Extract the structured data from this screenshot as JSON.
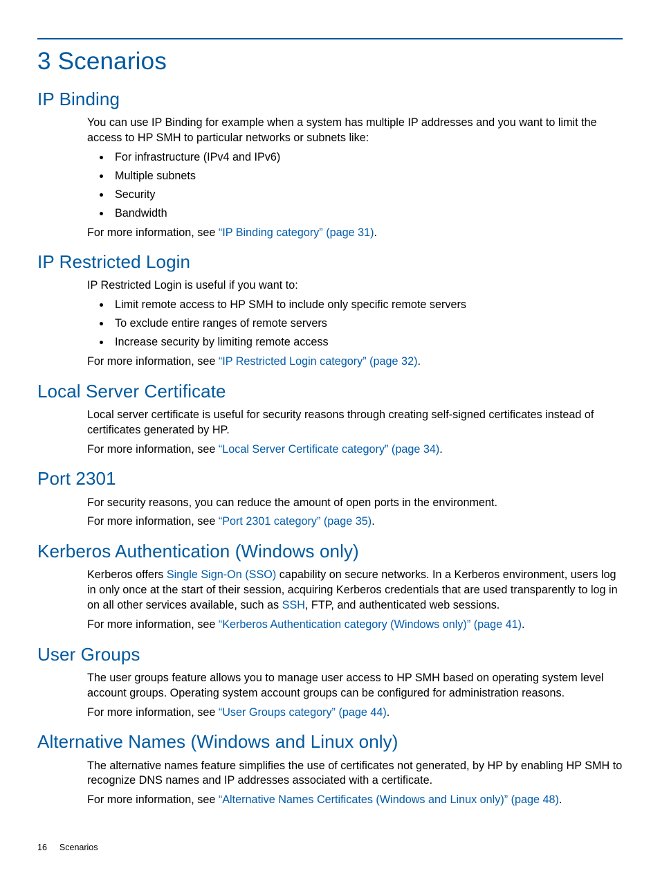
{
  "page": {
    "number": "16",
    "footer_label": "Scenarios",
    "title": "3 Scenarios"
  },
  "sections": {
    "ip_binding": {
      "heading": "IP Binding",
      "intro": "You can use IP Binding for example when a system has multiple IP addresses and you want to limit the access to HP SMH to particular networks or subnets like:",
      "bullets": {
        "b1": "For infrastructure (IPv4 and IPv6)",
        "b2": "Multiple subnets",
        "b3": "Security",
        "b4": "Bandwidth"
      },
      "more_prefix": "For more information, see ",
      "link": "“IP Binding category” (page 31)",
      "more_suffix": "."
    },
    "ip_restricted": {
      "heading": "IP Restricted Login",
      "intro": "IP Restricted Login is useful if you want to:",
      "bullets": {
        "b1": "Limit remote access to HP SMH to include only specific remote servers",
        "b2": "To exclude entire ranges of remote servers",
        "b3": "Increase security by limiting remote access"
      },
      "more_prefix": "For more information, see ",
      "link": "“IP Restricted Login category” (page 32)",
      "more_suffix": "."
    },
    "local_cert": {
      "heading": "Local Server Certificate",
      "intro": "Local server certificate is useful for security reasons through creating self-signed certificates instead of certificates generated by HP.",
      "more_prefix": "For more information, see ",
      "link": "“Local Server Certificate category” (page 34)",
      "more_suffix": "."
    },
    "port2301": {
      "heading": "Port 2301",
      "intro": "For security reasons, you can reduce the amount of open ports in the environment.",
      "more_prefix": "For more information, see ",
      "link": "“Port 2301 category” (page 35)",
      "more_suffix": "."
    },
    "kerberos": {
      "heading": "Kerberos Authentication (Windows only)",
      "p1a": "Kerberos offers ",
      "sso_link": "Single Sign-On (SSO)",
      "p1b": " capability on secure networks. In a Kerberos environment, users log in only once at the start of their session, acquiring Kerberos credentials that are used transparently to log in on all other services available, such as ",
      "ssh_link": "SSH",
      "p1c": ", FTP, and authenticated web sessions.",
      "more_prefix": "For more information, see ",
      "link": "“Kerberos Authentication category (Windows only)” (page 41)",
      "more_suffix": "."
    },
    "user_groups": {
      "heading": "User Groups",
      "intro": "The user groups feature allows you to manage user access to HP SMH based on operating system level account groups. Operating system account groups can be configured for administration reasons.",
      "more_prefix": "For more information, see ",
      "link": "“User Groups category” (page 44)",
      "more_suffix": "."
    },
    "alt_names": {
      "heading": "Alternative Names (Windows and Linux only)",
      "intro": "The alternative names feature simplifies the use of certificates not generated, by HP by enabling HP SMH to recognize DNS names and IP addresses associated with a certificate.",
      "more_prefix": "For more information, see ",
      "link": "“Alternative Names Certificates (Windows and Linux only)” (page 48)",
      "more_suffix": "."
    }
  }
}
